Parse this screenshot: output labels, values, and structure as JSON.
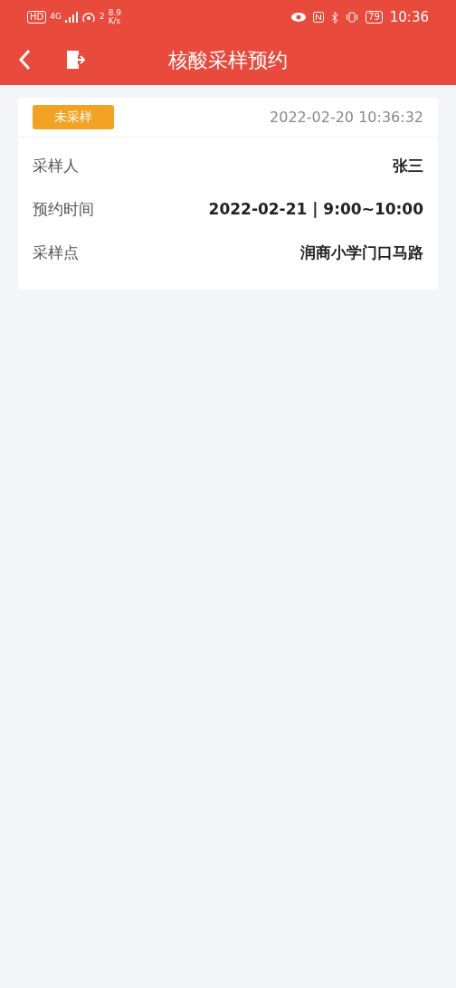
{
  "status_bar": {
    "hd": "HD",
    "network": "4G",
    "wifi_index": "2",
    "speed": "8.9",
    "speed_unit": "K/s",
    "battery": "79",
    "time": "10:36"
  },
  "header": {
    "title": "核酸采样预约"
  },
  "record": {
    "status": "未采样",
    "created": "2022-02-20 10:36:32",
    "fields": [
      {
        "label": "采样人",
        "value": "张三"
      },
      {
        "label": "预约时间",
        "value": "2022-02-21 | 9:00~10:00"
      },
      {
        "label": "采样点",
        "value": "润商小学门口马路"
      }
    ]
  }
}
